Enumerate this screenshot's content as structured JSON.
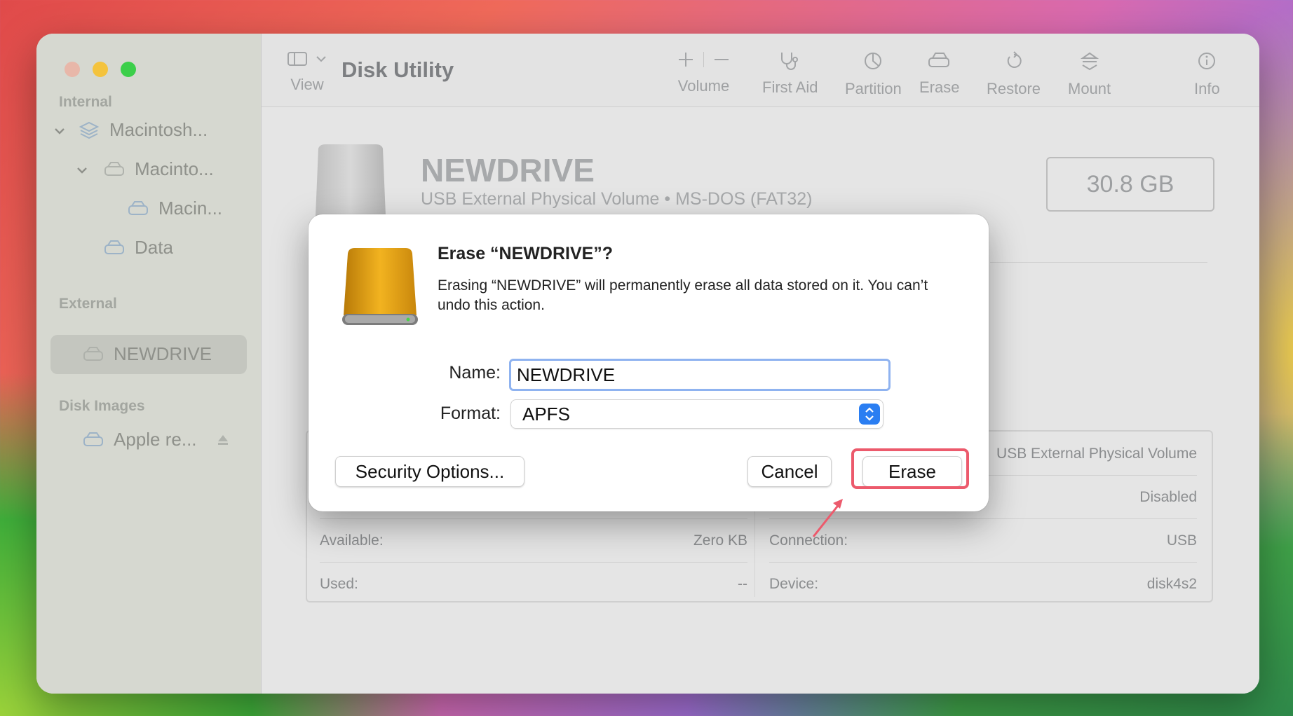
{
  "window": {
    "app_title": "Disk Utility"
  },
  "toolbar": {
    "view_label": "View",
    "volume_label": "Volume",
    "first_aid_label": "First Aid",
    "partition_label": "Partition",
    "erase_label": "Erase",
    "restore_label": "Restore",
    "mount_label": "Mount",
    "info_label": "Info"
  },
  "sidebar": {
    "internal_header": "Internal",
    "external_header": "External",
    "disk_images_header": "Disk Images",
    "items": [
      {
        "label": "Macintosh..."
      },
      {
        "label": "Macinto..."
      },
      {
        "label": "Macin..."
      },
      {
        "label": "Data"
      },
      {
        "label": "NEWDRIVE"
      },
      {
        "label": "Apple re..."
      }
    ]
  },
  "drive": {
    "name": "NEWDRIVE",
    "subtitle": "USB External Physical Volume • MS-DOS (FAT32)",
    "capacity": "30.8 GB"
  },
  "info": {
    "left": [
      {
        "label": "Available:",
        "value": "Zero KB"
      },
      {
        "label": "Used:",
        "value": "--"
      }
    ],
    "right": [
      {
        "label": "",
        "value": "USB External Physical Volume"
      },
      {
        "label": "",
        "value": "Disabled"
      },
      {
        "label": "Connection:",
        "value": "USB"
      },
      {
        "label": "Device:",
        "value": "disk4s2"
      }
    ]
  },
  "dialog": {
    "title": "Erase “NEWDRIVE”?",
    "message": "Erasing “NEWDRIVE” will permanently erase all data stored on it. You can’t undo this action.",
    "name_label": "Name:",
    "name_value": "NEWDRIVE",
    "format_label": "Format:",
    "format_value": "APFS",
    "security_button": "Security Options...",
    "cancel_button": "Cancel",
    "erase_button": "Erase"
  },
  "colors": {
    "highlight": "#ec5a6c",
    "accent": "#2a7ef2"
  }
}
